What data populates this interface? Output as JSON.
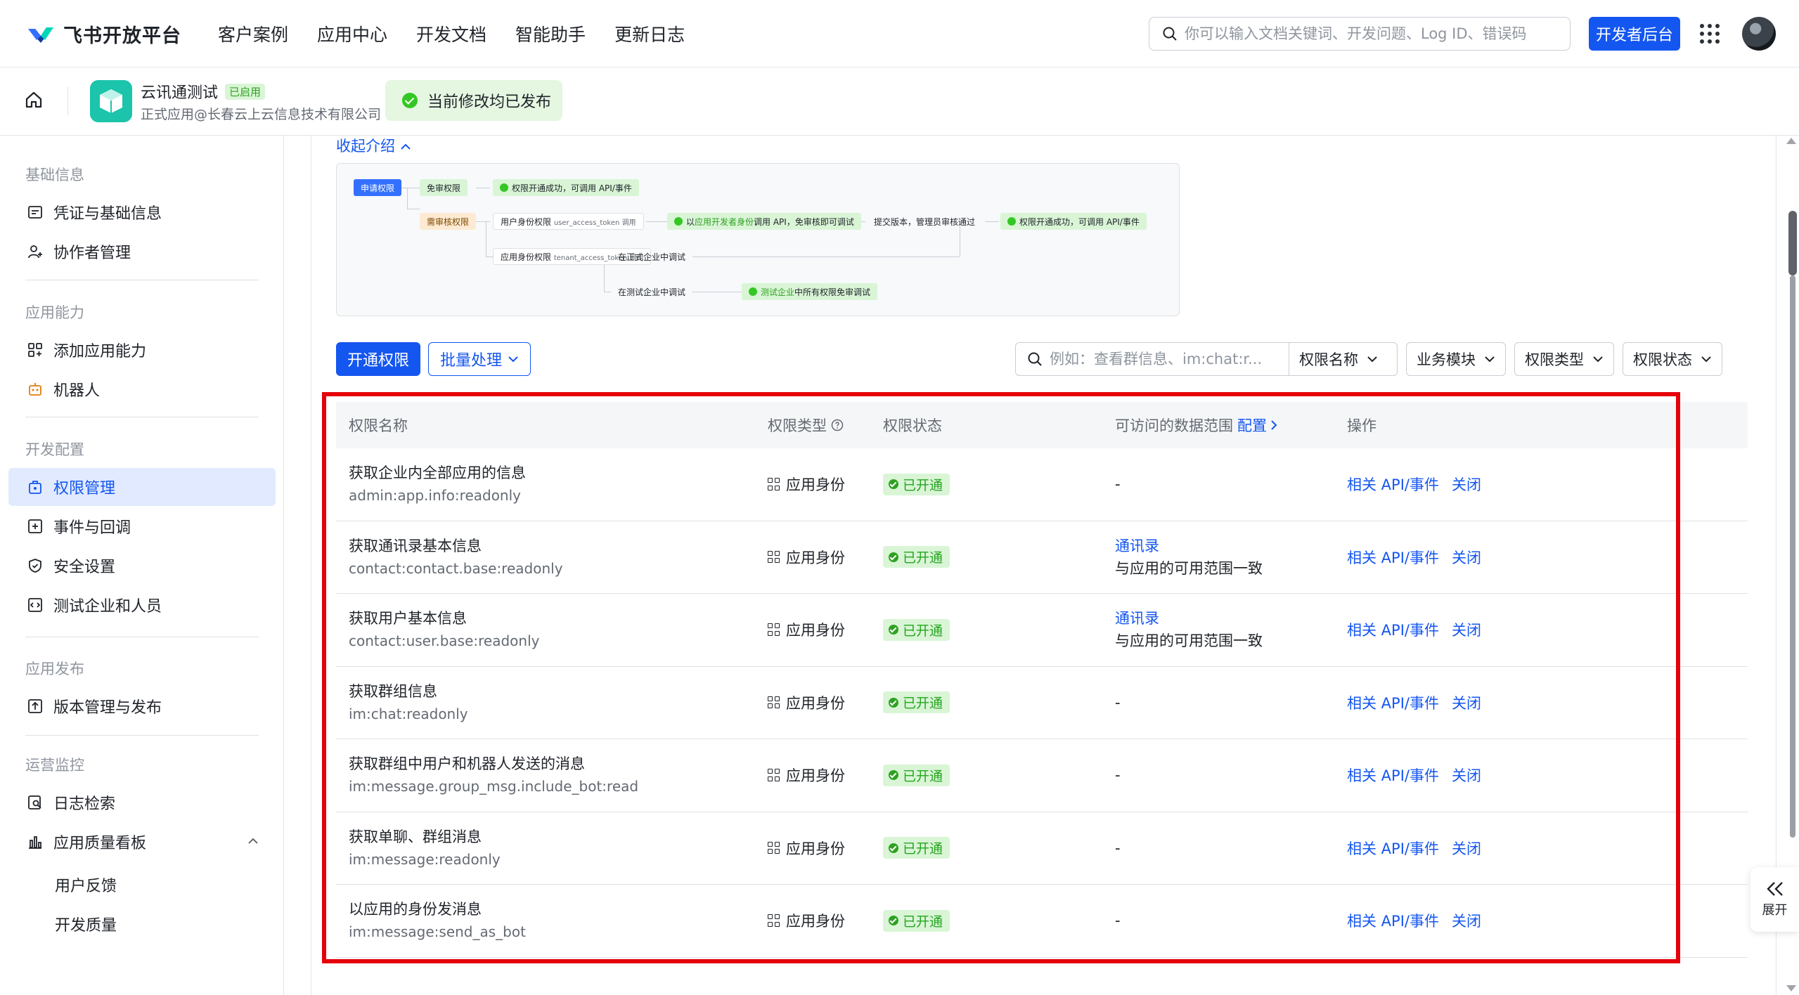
{
  "topnav": {
    "brand": "飞书开放平台",
    "links": [
      "客户案例",
      "应用中心",
      "开发文档",
      "智能助手",
      "更新日志"
    ],
    "search_placeholder": "你可以输入文档关键词、开发问题、Log ID、错误码",
    "dev_console": "开发者后台"
  },
  "subheader": {
    "app_name": "云讯通测试",
    "app_status": "已启用",
    "app_subtitle": "正式应用@长春云上云信息技术有限公司",
    "toast": "当前修改均已发布"
  },
  "sidebar": {
    "groups": [
      {
        "title": "基础信息",
        "items": [
          "凭证与基础信息",
          "协作者管理"
        ]
      },
      {
        "title": "应用能力",
        "items": [
          "添加应用能力",
          "机器人"
        ]
      },
      {
        "title": "开发配置",
        "items": [
          "权限管理",
          "事件与回调",
          "安全设置",
          "测试企业和人员"
        ]
      },
      {
        "title": "应用发布",
        "items": [
          "版本管理与发布"
        ]
      },
      {
        "title": "运营监控",
        "items": [
          "日志检索",
          "应用质量看板"
        ]
      }
    ],
    "subitems": [
      "用户反馈",
      "开发质量"
    ],
    "active": "权限管理"
  },
  "intro": {
    "collapse_label": "收起介绍",
    "flow": {
      "apply": "申请权限",
      "free": "免审权限",
      "free_result": "权限开通成功，可调用 API/事件",
      "review": "需审核权限",
      "user_perm": "用户身份权限",
      "user_token": "user_access_token 调用",
      "dev_call_a": "以",
      "dev_call_hl": "应用开发者身份",
      "dev_call_b": "调用 API，免审核即可调试",
      "submit": "提交版本，管理员审核通过",
      "final_result": "权限开通成功，可调用 API/事件",
      "app_perm": "应用身份权限",
      "tenant_token": "tenant_access_token 调用",
      "in_prod": "在正式企业中调试",
      "in_test": "在测试企业中调试",
      "test_hl": "测试企业",
      "test_result": "中所有权限免审调试"
    }
  },
  "toolbar": {
    "open_perm": "开通权限",
    "batch": "批量处理",
    "search_placeholder": "例如：查看群信息、im:chat:r...",
    "filters": [
      "权限名称",
      "业务模块",
      "权限类型",
      "权限状态"
    ]
  },
  "table": {
    "headers": [
      "权限名称",
      "权限类型",
      "权限状态",
      "可访问的数据范围",
      "操作"
    ],
    "config_link": "配置",
    "rows": [
      {
        "name": "获取企业内全部应用的信息",
        "code": "admin:app.info:readonly",
        "type": "应用身份",
        "status": "已开通",
        "scope": "-",
        "scope_link": "",
        "scope_desc": "",
        "api": "相关 API/事件",
        "close": "关闭"
      },
      {
        "name": "获取通讯录基本信息",
        "code": "contact:contact.base:readonly",
        "type": "应用身份",
        "status": "已开通",
        "scope": "",
        "scope_link": "通讯录",
        "scope_desc": "与应用的可用范围一致",
        "api": "相关 API/事件",
        "close": "关闭"
      },
      {
        "name": "获取用户基本信息",
        "code": "contact:user.base:readonly",
        "type": "应用身份",
        "status": "已开通",
        "scope": "",
        "scope_link": "通讯录",
        "scope_desc": "与应用的可用范围一致",
        "api": "相关 API/事件",
        "close": "关闭"
      },
      {
        "name": "获取群组信息",
        "code": "im:chat:readonly",
        "type": "应用身份",
        "status": "已开通",
        "scope": "-",
        "scope_link": "",
        "scope_desc": "",
        "api": "相关 API/事件",
        "close": "关闭"
      },
      {
        "name": "获取群组中用户和机器人发送的消息",
        "code": "im:message.group_msg.include_bot:read",
        "type": "应用身份",
        "status": "已开通",
        "scope": "-",
        "scope_link": "",
        "scope_desc": "",
        "api": "相关 API/事件",
        "close": "关闭"
      },
      {
        "name": "获取单聊、群组消息",
        "code": "im:message:readonly",
        "type": "应用身份",
        "status": "已开通",
        "scope": "-",
        "scope_link": "",
        "scope_desc": "",
        "api": "相关 API/事件",
        "close": "关闭"
      },
      {
        "name": "以应用的身份发消息",
        "code": "im:message:send_as_bot",
        "type": "应用身份",
        "status": "已开通",
        "scope": "-",
        "scope_link": "",
        "scope_desc": "",
        "api": "相关 API/事件",
        "close": "关闭"
      }
    ]
  },
  "expand_panel": {
    "label": "展开"
  },
  "colors": {
    "primary": "#1456f0",
    "success": "#2ea121",
    "highlight_box": "#e5000a"
  }
}
